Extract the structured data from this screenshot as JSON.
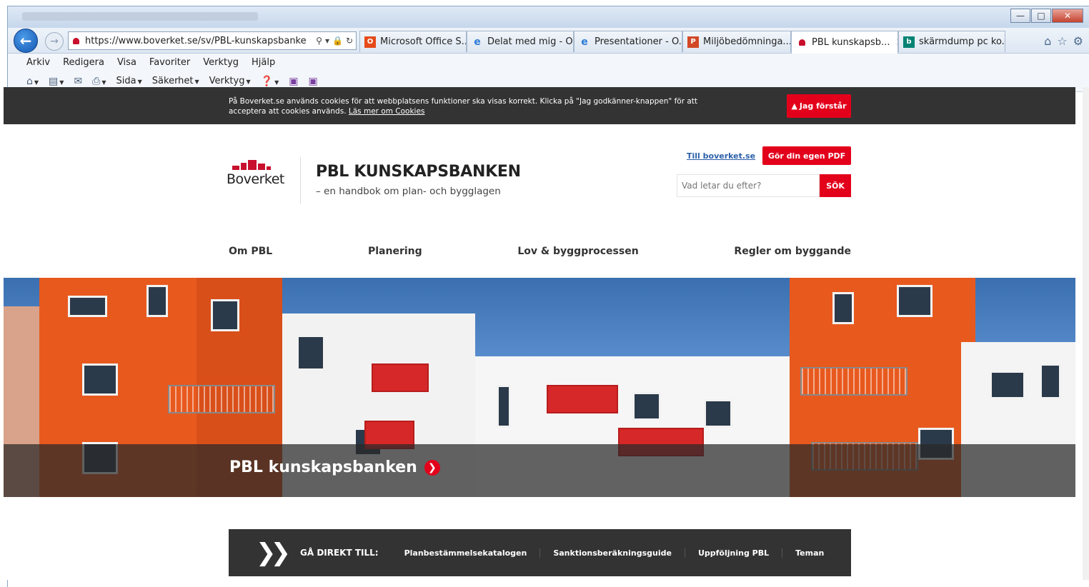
{
  "browser": {
    "url": "https://www.boverket.se/sv/PBL-kunskapsbanke",
    "tabs": [
      {
        "label": "Microsoft Office S...",
        "icon": "office-icon",
        "color": "#e64a19"
      },
      {
        "label": "Delat med mig - O...",
        "icon": "ie-icon",
        "color": "#2b7bd6"
      },
      {
        "label": "Presentationer - O...",
        "icon": "ie-icon",
        "color": "#2b7bd6"
      },
      {
        "label": "Miljöbedömninga...",
        "icon": "powerpoint-icon",
        "color": "#d24726"
      },
      {
        "label": "PBL kunskapsb...",
        "icon": "boverket-favicon",
        "color": "#c8102e",
        "active": true
      },
      {
        "label": "skärmdump pc ko...",
        "icon": "bing-icon",
        "color": "#008373"
      }
    ],
    "menu": [
      "Arkiv",
      "Redigera",
      "Visa",
      "Favoriter",
      "Verktyg",
      "Hjälp"
    ],
    "commands": {
      "page": "Sida",
      "safety": "Säkerhet",
      "tools": "Verktyg"
    }
  },
  "cookie": {
    "text": "På Boverket.se används cookies för att webbplatsens funktioner ska visas korrekt. Klicka på \"Jag godkänner-knappen\" för att acceptera att cookies används.",
    "link": "Läs mer om Cookies",
    "accept": "Jag förstår"
  },
  "header": {
    "logo_text": "Boverket",
    "title": "PBL KUNSKAPSBANKEN",
    "subtitle": "– en handbok om plan- och bygglagen",
    "to_boverket": "Till boverket.se",
    "pdf_button": "Gör din egen PDF",
    "search_placeholder": "Vad letar du efter?",
    "search_button": "SÖK"
  },
  "nav": [
    "Om PBL",
    "Planering",
    "Lov & byggprocessen",
    "Regler om byggande"
  ],
  "hero": {
    "title": "PBL kunskapsbanken"
  },
  "direct": {
    "label": "GÅ DIREKT TILL:",
    "links": [
      "Planbestämmelsekatalogen",
      "Sanktionsberäkningsguide",
      "Uppföljning PBL",
      "Teman"
    ]
  },
  "colors": {
    "brand_red": "#e3001b",
    "dark_band": "#333333",
    "orange": "#e8591e"
  }
}
